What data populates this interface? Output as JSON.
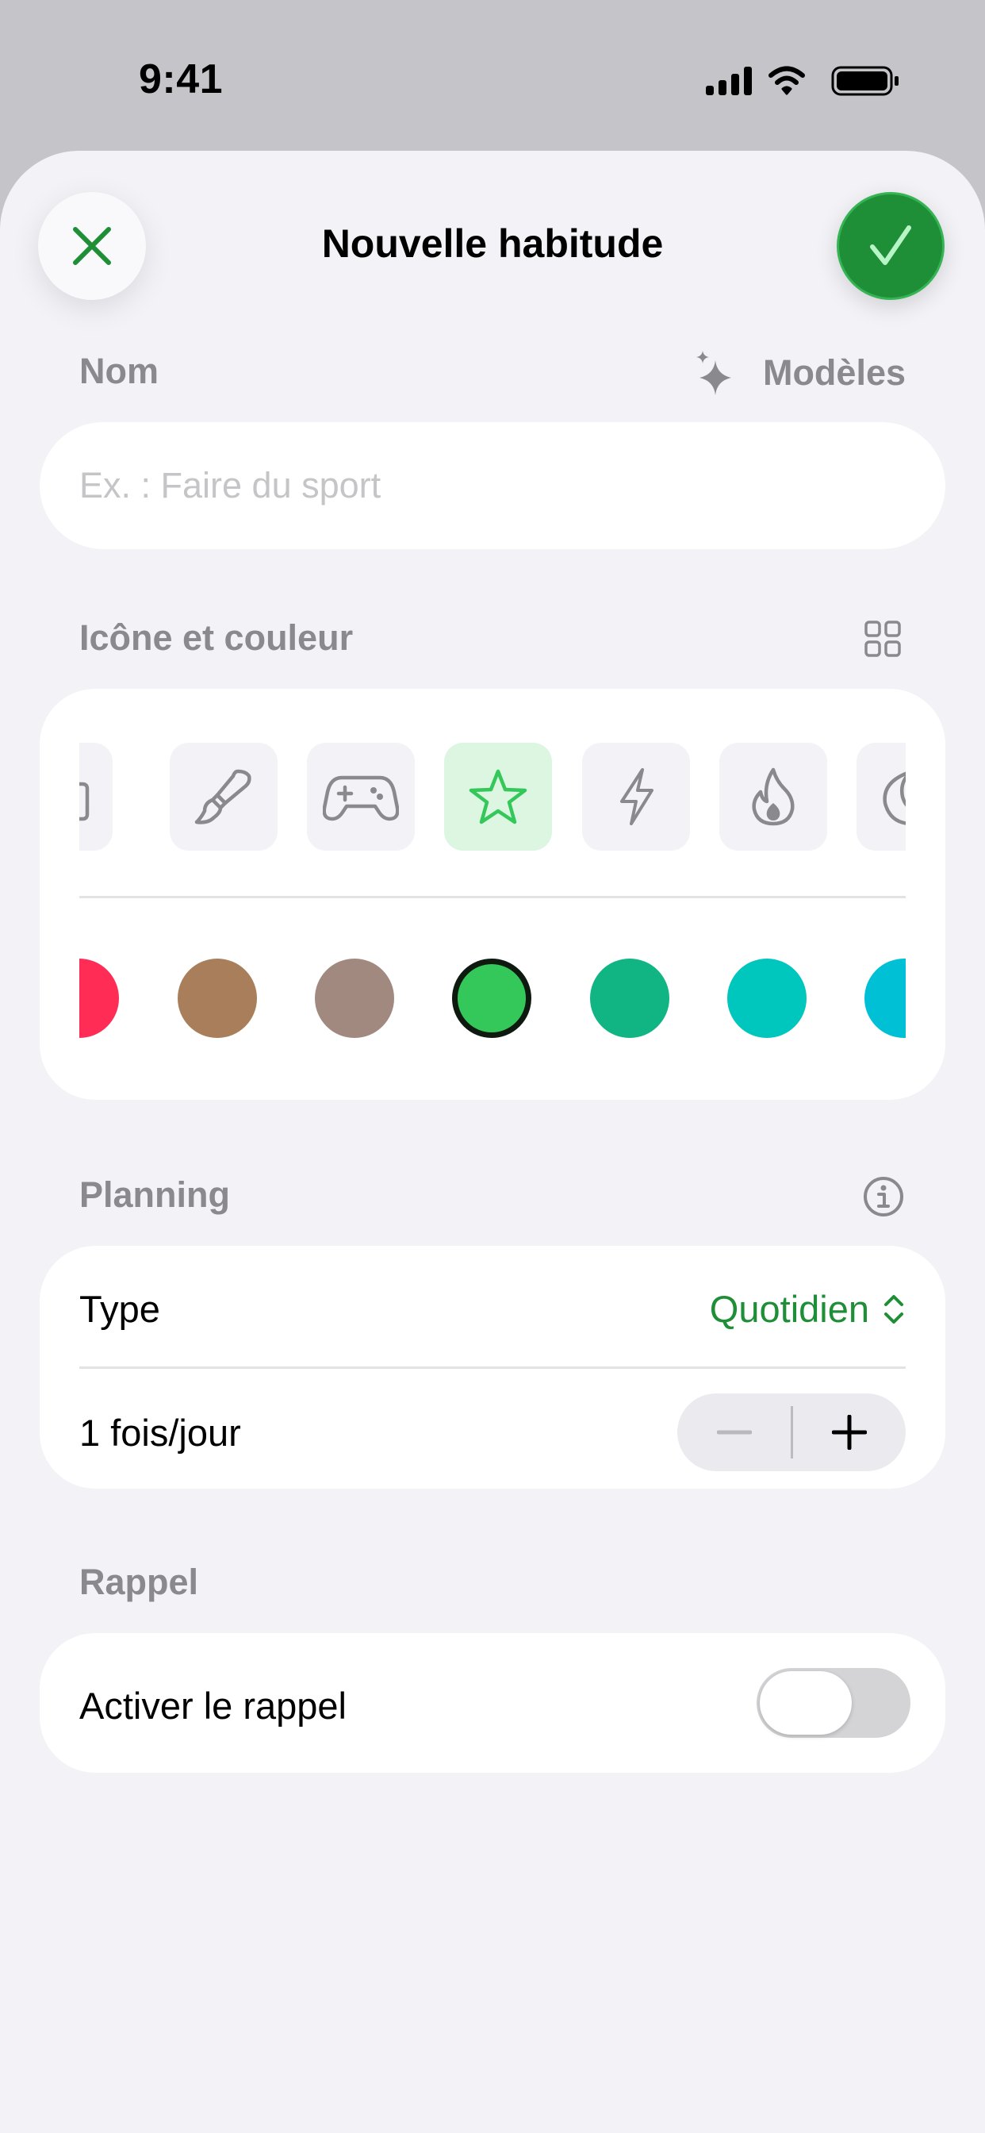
{
  "status_bar": {
    "time": "9:41",
    "icons": [
      "cellular-signal-icon",
      "wifi-icon",
      "battery-icon"
    ]
  },
  "header": {
    "title": "Nouvelle habitude",
    "close_icon": "close-icon",
    "confirm_icon": "checkmark-icon"
  },
  "name_section": {
    "label": "Nom",
    "templates_label": "Modèles",
    "templates_icon": "sparkles-icon",
    "placeholder": "Ex. : Faire du sport",
    "value": ""
  },
  "icon_section": {
    "label": "Icône et couleur",
    "grid_icon": "grid-icon",
    "icons": [
      {
        "name": "camera-icon",
        "selected": false
      },
      {
        "name": "paintbrush-icon",
        "selected": false
      },
      {
        "name": "gamepad-icon",
        "selected": false
      },
      {
        "name": "star-icon",
        "selected": true
      },
      {
        "name": "bolt-icon",
        "selected": false
      },
      {
        "name": "flame-icon",
        "selected": false
      },
      {
        "name": "moon-icon",
        "selected": false
      }
    ],
    "colors": [
      {
        "hex": "#ff2d55",
        "selected": false
      },
      {
        "hex": "#a97f5b",
        "selected": false
      },
      {
        "hex": "#a18980",
        "selected": false
      },
      {
        "hex": "#34c759",
        "selected": true
      },
      {
        "hex": "#11b584",
        "selected": false
      },
      {
        "hex": "#00c7be",
        "selected": false
      },
      {
        "hex": "#00c0d6",
        "selected": false
      }
    ]
  },
  "planning_section": {
    "label": "Planning",
    "info_icon": "info-icon",
    "type_label": "Type",
    "type_value": "Quotidien",
    "frequency_label": "1 fois/jour",
    "stepper_minus_icon": "minus-icon",
    "stepper_plus_icon": "plus-icon"
  },
  "reminder_section": {
    "label": "Rappel",
    "toggle_label": "Activer le rappel",
    "toggle_on": false
  },
  "colors": {
    "accent": "#1e8e37",
    "secondary_text": "#8a8a8e",
    "background": "#f2f2f7"
  }
}
